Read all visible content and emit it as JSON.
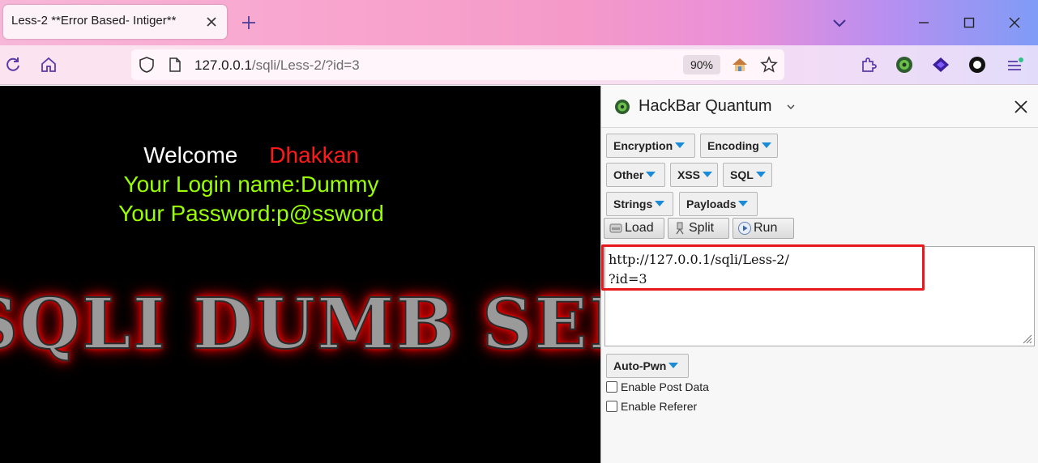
{
  "browser": {
    "tab_title": "Less-2 **Error Based- Intiger**",
    "url_host": "127.0.0.1",
    "url_path": "/sqli/Less-2/?id=3",
    "zoom": "90%"
  },
  "page": {
    "welcome_label": "Welcome",
    "welcome_name": "Dhakkan",
    "login_line": "Your Login name:Dummy",
    "password_line": "Your Password:p@ssword",
    "banner_text": "SQLI DUMB SERIES"
  },
  "hackbar": {
    "title": "HackBar Quantum",
    "menus": {
      "encryption": "Encryption",
      "encoding": "Encoding",
      "other": "Other",
      "xss": "XSS",
      "sql": "SQL",
      "strings": "Strings",
      "payloads": "Payloads",
      "auto_pwn": "Auto-Pwn"
    },
    "buttons": {
      "load": "Load",
      "split": "Split",
      "run": "Run"
    },
    "url_field_line1": "http://127.0.0.1/sqli/Less-2/",
    "url_field_line2": "?id=3",
    "enable_post": "Enable Post Data",
    "enable_referer": "Enable Referer"
  },
  "colors": {
    "highlight_box": "#e8191c",
    "dropdown_arrow": "#1a8bd6",
    "welcome_name": "#ff1a1a",
    "login_text": "#99ff00"
  }
}
